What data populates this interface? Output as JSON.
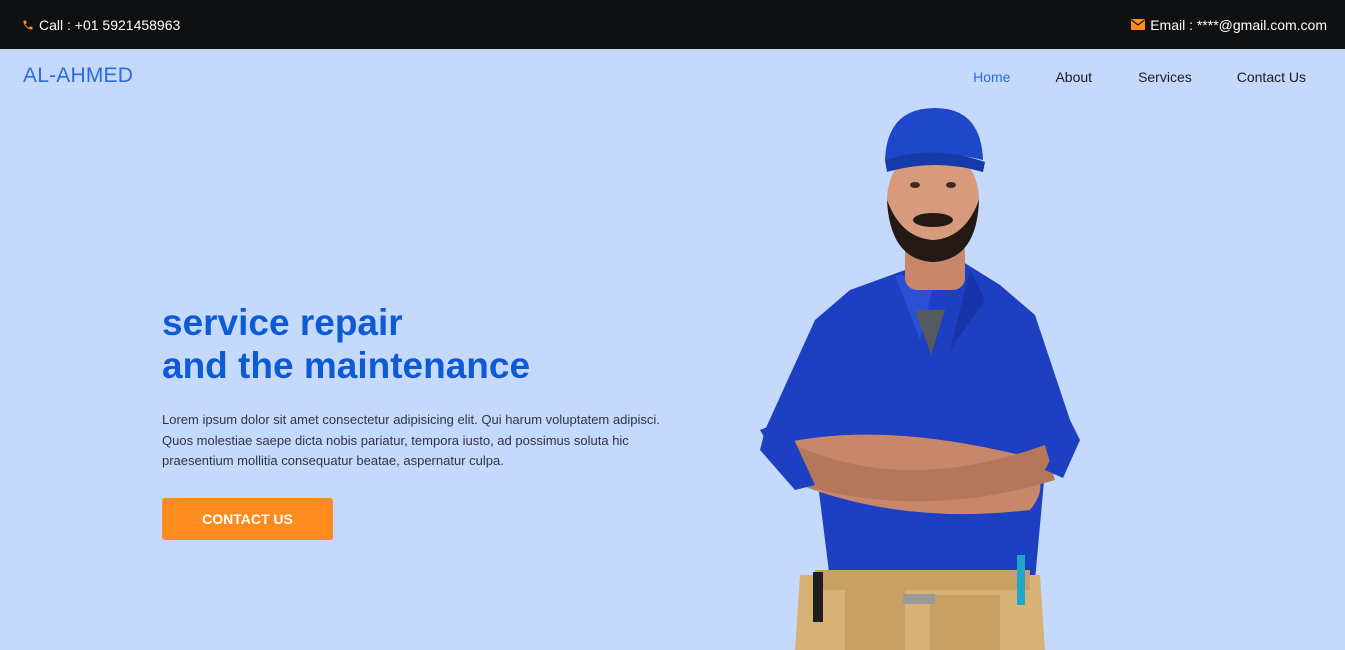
{
  "topbar": {
    "phone_label": "Call : +01 5921458963",
    "email_label": "Email : ****@gmail.com.com",
    "phone_icon": "phone-icon",
    "email_icon": "envelope-icon",
    "icon_color": "#fd8b1f"
  },
  "brand": {
    "name": "AL-AHMED"
  },
  "nav": {
    "items": [
      {
        "label": "Home",
        "active": true
      },
      {
        "label": "About",
        "active": false
      },
      {
        "label": "Services",
        "active": false
      },
      {
        "label": "Contact Us",
        "active": false
      }
    ]
  },
  "hero": {
    "title_line1": "service repair",
    "title_line2": "and the maintenance",
    "description": "Lorem ipsum dolor sit amet consectetur adipisicing elit. Qui harum voluptatem adipisci. Quos molestiae saepe dicta nobis pariatur, tempora iusto, ad possimus soluta hic praesentium mollitia consequatur beatae, aspernatur culpa.",
    "cta_label": "CONTACT US"
  },
  "colors": {
    "background": "#c5d9fd",
    "topbar": "#0f1012",
    "accent": "#2a6be0",
    "heading": "#0e5ad4",
    "button": "#fd8b1f"
  }
}
